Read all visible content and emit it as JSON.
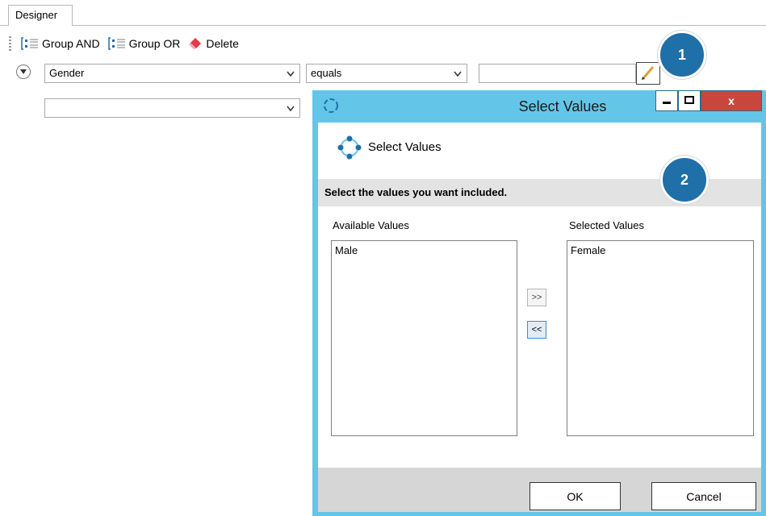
{
  "tab": {
    "label": "Designer"
  },
  "toolbar": {
    "group_and": "Group AND",
    "group_or": "Group OR",
    "delete": "Delete"
  },
  "filter": {
    "field": "Gender",
    "operator": "equals",
    "value": "",
    "second_field": ""
  },
  "badges": {
    "one": "1",
    "two": "2"
  },
  "dialog": {
    "title": "Select Values",
    "header_title": "Select Values",
    "instruction": "Select the values you want included.",
    "available_label": "Available Values",
    "selected_label": "Selected Values",
    "available_values": [
      "Male"
    ],
    "selected_values": [
      "Female"
    ],
    "add_button": ">>",
    "remove_button": "<<",
    "ok": "OK",
    "cancel": "Cancel",
    "close_glyph": "x"
  },
  "colors": {
    "dialog_frame": "#63c6e8",
    "badge": "#1f6fa8",
    "close_button": "#c9463d",
    "footer": "#d6d6d6",
    "instruction_band": "#e3e3e3"
  },
  "icons": [
    "group-and-icon",
    "group-or-icon",
    "eraser-icon",
    "expand-circle-icon",
    "pencil-icon",
    "app-logo-icon",
    "minimize-icon",
    "maximize-icon",
    "close-icon",
    "chevron-down-icon"
  ]
}
